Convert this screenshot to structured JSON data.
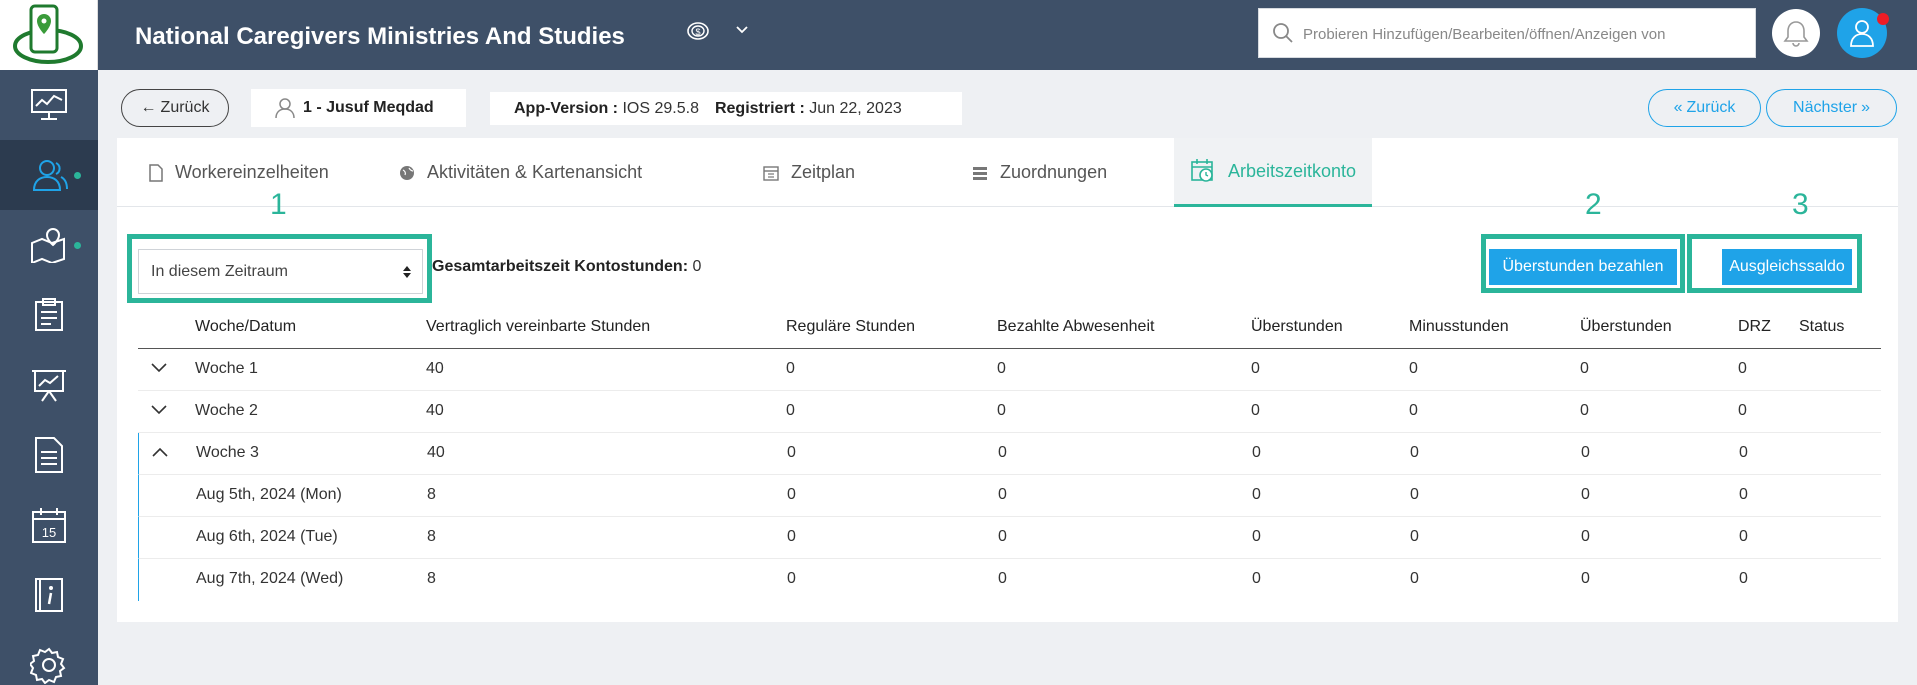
{
  "header": {
    "title": "National Caregivers Ministries And Studies",
    "search_placeholder": "Probieren Hinzufügen/Bearbeiten/öffnen/Anzeigen von"
  },
  "sidebar": {
    "items": [
      {
        "name": "dashboard-icon",
        "active": false
      },
      {
        "name": "users-icon",
        "active": true,
        "dot": true
      },
      {
        "name": "map-location-icon",
        "active": false,
        "dot": true
      },
      {
        "name": "clipboard-icon",
        "active": false
      },
      {
        "name": "presentation-chart-icon",
        "active": false
      },
      {
        "name": "document-icon",
        "active": false
      },
      {
        "name": "calendar-15-icon",
        "active": false
      },
      {
        "name": "info-book-icon",
        "active": false
      },
      {
        "name": "settings-gear-icon",
        "active": false
      }
    ],
    "calendar_day": "15"
  },
  "infobar": {
    "back_label": "Zurück",
    "worker_label": "1 - Jusuf Meqdad",
    "app_version_label": "App-Version :",
    "app_version_value": "IOS 29.5.8",
    "registered_label": "Registriert :",
    "registered_value": "Jun 22, 2023",
    "prev_label": "Zurück",
    "next_label": "Nächster"
  },
  "tabs": [
    {
      "label": "Workereinzelheiten",
      "icon": "file-icon"
    },
    {
      "label": "Aktivitäten & Kartenansicht",
      "icon": "globe-icon"
    },
    {
      "label": "Zeitplan",
      "icon": "calendar-icon"
    },
    {
      "label": "Zuordnungen",
      "icon": "list-icon"
    },
    {
      "label": "Arbeitszeitkonto",
      "icon": "calendar-clock-icon",
      "active": true
    }
  ],
  "annotations": [
    "1",
    "2",
    "3"
  ],
  "toolbar": {
    "period_select": "In diesem Zeitraum",
    "total_label": "Gesamtarbeitszeit Kontostunden:",
    "total_value": "0",
    "pay_overtime_button": "Überstunden bezahlen",
    "balance_button": "Ausgleichssaldo"
  },
  "table": {
    "columns": [
      "Woche/Datum",
      "Vertraglich vereinbarte Stunden",
      "Reguläre Stunden",
      "Bezahlte Abwesenheit",
      "Überstunden",
      "Minusstunden",
      "Überstunden",
      "DRZ",
      "Status"
    ],
    "rows": [
      {
        "week": "Woche 1",
        "expand": "down",
        "cells": [
          "40",
          "0",
          "0",
          "0",
          "0",
          "0",
          "0",
          ""
        ]
      },
      {
        "week": "Woche 2",
        "expand": "down",
        "cells": [
          "40",
          "0",
          "0",
          "0",
          "0",
          "0",
          "0",
          ""
        ]
      },
      {
        "week": "Woche 3",
        "expand": "up",
        "cells": [
          "40",
          "0",
          "0",
          "0",
          "0",
          "0",
          "0",
          ""
        ]
      },
      {
        "week": "Aug 5th, 2024 (Mon)",
        "expand": "",
        "cells": [
          "8",
          "0",
          "0",
          "0",
          "0",
          "0",
          "0",
          ""
        ]
      },
      {
        "week": "Aug 6th, 2024 (Tue)",
        "expand": "",
        "cells": [
          "8",
          "0",
          "0",
          "0",
          "0",
          "0",
          "0",
          ""
        ]
      },
      {
        "week": "Aug 7th, 2024 (Wed)",
        "expand": "",
        "cells": [
          "8",
          "0",
          "0",
          "0",
          "0",
          "0",
          "0",
          ""
        ]
      }
    ]
  },
  "colors": {
    "sidebar": "#3e5068",
    "accent_green": "#2bb59a",
    "accent_blue": "#1fa3e8",
    "notification_red": "#ee1c25"
  }
}
